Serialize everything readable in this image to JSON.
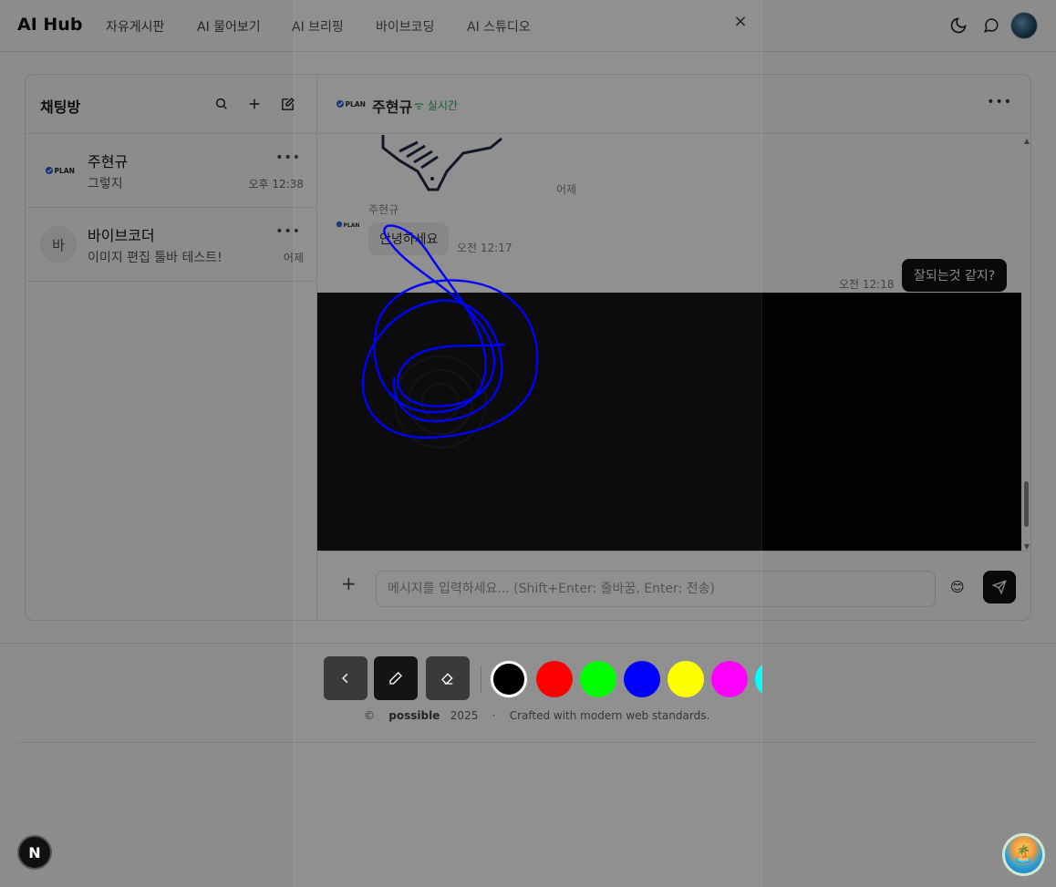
{
  "header": {
    "brand": "AI Hub",
    "nav": [
      "자유게시판",
      "AI 물어보기",
      "AI 브리핑",
      "바이브코딩",
      "AI 스튜디오"
    ]
  },
  "sidebar": {
    "title": "채팅방",
    "rooms": [
      {
        "name": "주현규",
        "last": "그렇지",
        "time": "오후 12:38",
        "avatar": "PLAN"
      },
      {
        "name": "바이브코더",
        "last": "이미지 편집 툴바 테스트!",
        "time": "어제",
        "avatar": "바"
      }
    ]
  },
  "chat": {
    "name": "주현규",
    "status": "실시간",
    "logo_text": "PLAN",
    "messages": {
      "date_label": "어제",
      "sender": "주현규",
      "incoming_text": "안녕하세요",
      "incoming_time": "오전 12:17",
      "outgoing_text": "잘되는것 같지?",
      "outgoing_time": "오전 12:18"
    },
    "input_placeholder": "메시지를 입력하세요... (Shift+Enter: 줄바꿈, Enter: 전송)",
    "emoji": "😊"
  },
  "footer": {
    "copyright": "©",
    "brand": "possible",
    "year": "2025",
    "separator": "·",
    "tagline": "Crafted with modern web standards."
  },
  "overlay": {
    "close": "×",
    "colors": [
      "#000000",
      "#ff0000",
      "#00ff00",
      "#0000ff",
      "#ffff00",
      "#ff00ff",
      "#00ffff"
    ],
    "selected_color": "#000000",
    "stroke_color": "#0000ff"
  },
  "badges": {
    "next": "N",
    "beach": "🏝️"
  }
}
